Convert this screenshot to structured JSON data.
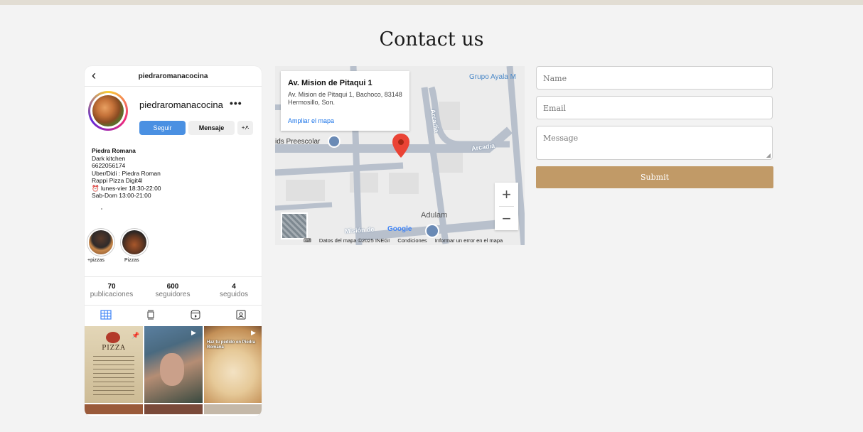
{
  "page": {
    "title": "Contact us"
  },
  "instagram": {
    "handle": "piedraromanacocina",
    "name": "piedraromanacocina",
    "more": "•••",
    "buttons": {
      "follow": "Seguir",
      "message": "Mensaje",
      "add": "+ዶ"
    },
    "bio": {
      "name": "Piedra Romana",
      "lines": [
        "Dark kitchen",
        "6622056174",
        "Uber/Didi : Piedra Roman",
        "Rappi Pizza Digit4l",
        "⏰ lunes-vier 18:30-22:00",
        "Sab-Dom 13:00-21:00"
      ]
    },
    "highlights": [
      {
        "label": "+pizzas"
      },
      {
        "label": "Pizzas"
      }
    ],
    "stats": [
      {
        "num": "70",
        "label": "publicaciones"
      },
      {
        "num": "600",
        "label": "seguidores"
      },
      {
        "num": "4",
        "label": "seguidos"
      }
    ],
    "posts": [
      {
        "caption": "PIZZA"
      },
      {
        "caption": ""
      },
      {
        "caption": "Haz tu pedido en Piedra Romana"
      }
    ]
  },
  "map": {
    "card": {
      "title": "Av. Mision de Pitaqui 1",
      "address": "Av. Mision de Pitaqui 1, Bachoco, 83148 Hermosillo, Son.",
      "link": "Ampliar el mapa"
    },
    "labels": {
      "grupo": "Grupo Ayala M",
      "preescolar": "ids Preescolar",
      "arcadia1": "Arcadia",
      "arcadia2": "Arcadia",
      "adulam": "Adulam",
      "mision": "Misión de",
      "google": "Google"
    },
    "zoom_in": "+",
    "zoom_out": "−",
    "footer": {
      "data": "Datos del mapa ©2025 INEGI",
      "terms": "Condiciones",
      "report": "Informar un error en el mapa"
    },
    "colors": {
      "road": "#b8c0cc",
      "pin": "#ea4335"
    }
  },
  "form": {
    "name_placeholder": "Name",
    "email_placeholder": "Email",
    "message_placeholder": "Message",
    "submit_label": "Submit",
    "accent": "#c19a67"
  }
}
